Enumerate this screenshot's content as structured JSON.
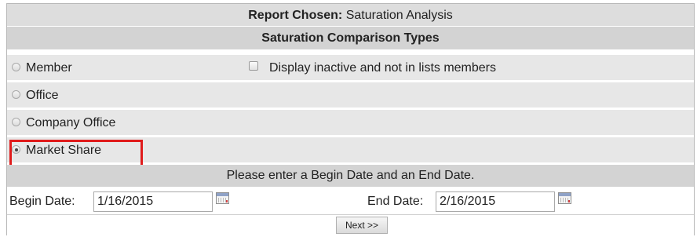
{
  "report": {
    "label": "Report Chosen:",
    "value": "Saturation Analysis"
  },
  "section_title": "Saturation Comparison Types",
  "options": [
    {
      "label": "Member",
      "checked": false
    },
    {
      "label": "Office",
      "checked": false
    },
    {
      "label": "Company Office",
      "checked": false
    },
    {
      "label": "Market Share",
      "checked": true
    }
  ],
  "inactive_checkbox": {
    "label": "Display inactive and not in lists members",
    "checked": false
  },
  "date_prompt": "Please enter a Begin Date and an End Date.",
  "begin_date": {
    "label": "Begin Date:",
    "value": "1/16/2015"
  },
  "end_date": {
    "label": "End Date:",
    "value": "2/16/2015"
  },
  "next_button": "Next >>",
  "highlight_color": "#e01b1b",
  "icons": [
    "radio-button",
    "checkbox",
    "calendar-icon"
  ]
}
